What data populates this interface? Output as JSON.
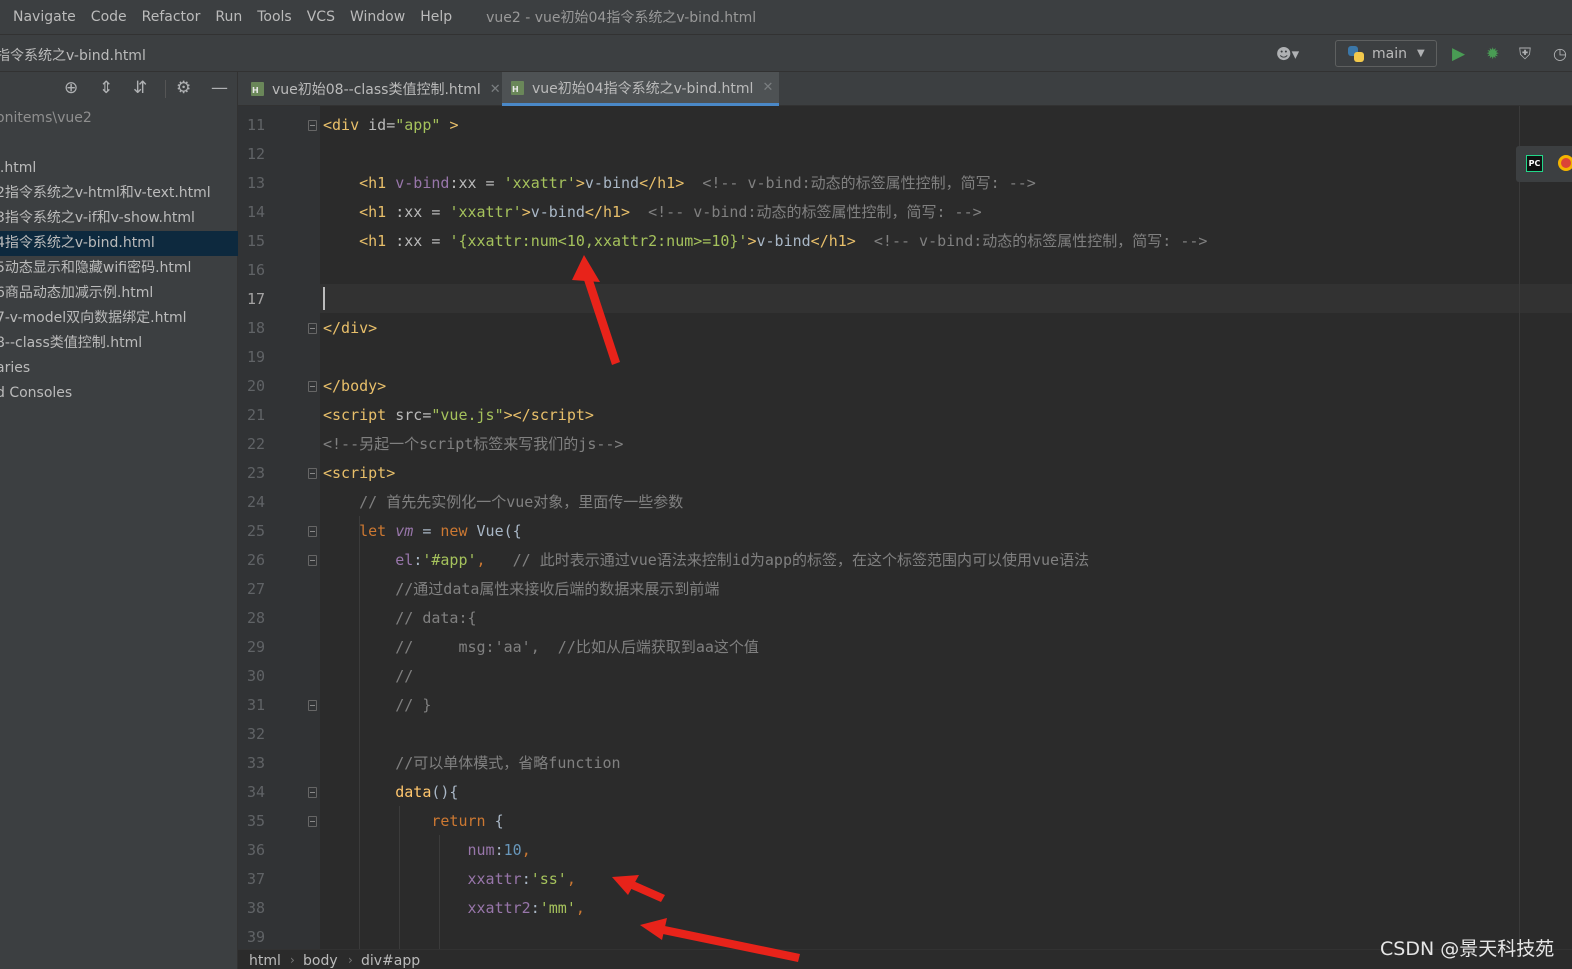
{
  "menu": {
    "items": [
      "Navigate",
      "Code",
      "Refactor",
      "Run",
      "Tools",
      "VCS",
      "Window",
      "Help"
    ],
    "window_title": "vue2 - vue初始04指令系统之v-bind.html"
  },
  "navbar": {
    "breadcrumb": "指令系统之v-bind.html",
    "run_config": "main"
  },
  "project": {
    "tree": [
      {
        "label": "onitems\\vue2",
        "dim": true
      },
      {
        "label": ""
      },
      {
        "label": "l.html"
      },
      {
        "label": "2指令系统之v-html和v-text.html"
      },
      {
        "label": "3指令系统之v-if和v-show.html"
      },
      {
        "label": "4指令系统之v-bind.html",
        "selected": true
      },
      {
        "label": "5动态显示和隐藏wifi密码.html"
      },
      {
        "label": "6商品动态加减示例.html"
      },
      {
        "label": "7-v-model双向数据绑定.html"
      },
      {
        "label": "8--class类值控制.html"
      },
      {
        "label": "aries"
      },
      {
        "label": "d Consoles"
      }
    ]
  },
  "tabs": [
    {
      "label": "vue初始08--class类值控制.html",
      "active": false
    },
    {
      "label": "vue初始04指令系统之v-bind.html",
      "active": true
    }
  ],
  "editor": {
    "line_numbers": [
      "11",
      "12",
      "13",
      "14",
      "15",
      "16",
      "17",
      "18",
      "19",
      "20",
      "21",
      "22",
      "23",
      "24",
      "25",
      "26",
      "27",
      "28",
      "29",
      "30",
      "31",
      "32",
      "33",
      "34",
      "35",
      "36",
      "37",
      "38",
      "39"
    ],
    "current_line": "17"
  },
  "breadcrumbs": [
    "html",
    "body",
    "div#app"
  ],
  "watermark": "CSDN @景天科技苑",
  "colors": {
    "background": "#2b2b2b",
    "gutter": "#313335",
    "panel": "#3c3f41",
    "selection": "#0d293e",
    "accent_tab": "#4a88c7",
    "arrow": "#e8231a"
  }
}
